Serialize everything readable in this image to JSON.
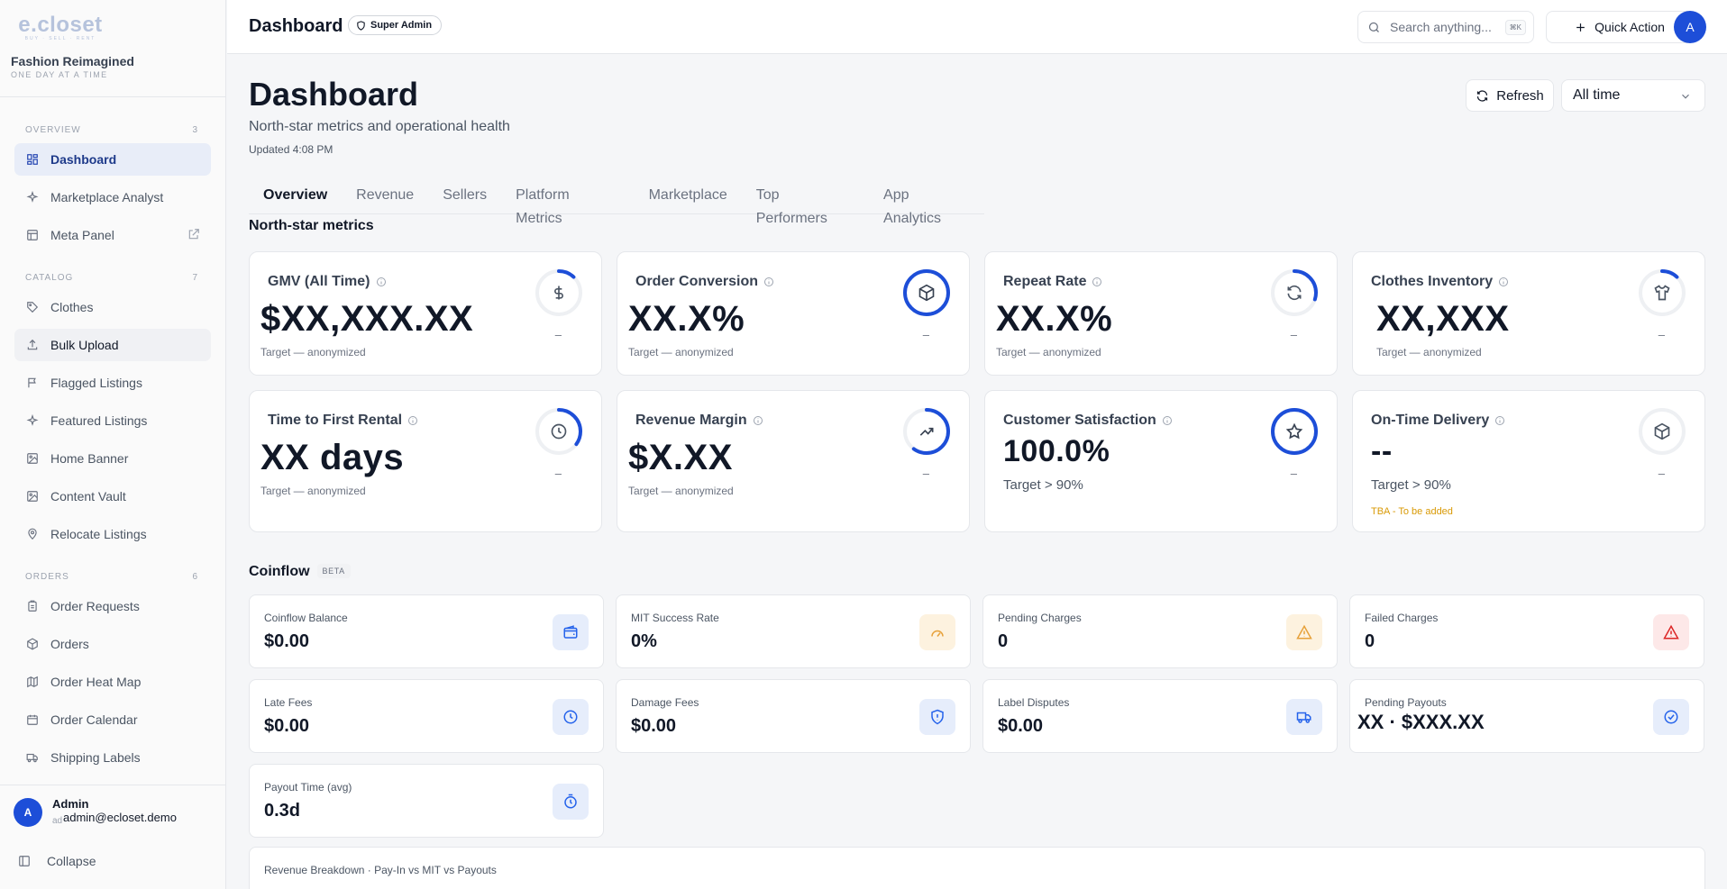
{
  "brand": {
    "logo": "e.closet",
    "logo_tagline": "BUY · SELL · RENT",
    "title": "Fashion Reimagined",
    "tagline": "ONE DAY AT A TIME"
  },
  "sidebar": {
    "sections": [
      {
        "label": "OVERVIEW",
        "count": "3",
        "items": [
          {
            "label": "Dashboard",
            "icon": "grid-icon",
            "state": "active"
          },
          {
            "label": "Marketplace Analyst",
            "icon": "sparkles-icon"
          },
          {
            "label": "Meta Panel",
            "icon": "table-icon",
            "external": true
          }
        ]
      },
      {
        "label": "CATALOG",
        "count": "7",
        "items": [
          {
            "label": "Clothes",
            "icon": "tag-icon"
          },
          {
            "label": "Bulk Upload",
            "icon": "upload-icon",
            "state": "hover"
          },
          {
            "label": "Flagged Listings",
            "icon": "flag-icon"
          },
          {
            "label": "Featured Listings",
            "icon": "sparkles-icon"
          },
          {
            "label": "Home Banner",
            "icon": "image-icon"
          },
          {
            "label": "Content Vault",
            "icon": "image-icon"
          },
          {
            "label": "Relocate Listings",
            "icon": "map-pin-icon"
          }
        ]
      },
      {
        "label": "ORDERS",
        "count": "6",
        "items": [
          {
            "label": "Order Requests",
            "icon": "clipboard-icon"
          },
          {
            "label": "Orders",
            "icon": "package-icon"
          },
          {
            "label": "Order Heat Map",
            "icon": "map-icon"
          },
          {
            "label": "Order Calendar",
            "icon": "calendar-icon"
          },
          {
            "label": "Shipping Labels",
            "icon": "truck-icon"
          }
        ]
      }
    ],
    "user": {
      "initial": "A",
      "name": "Admin",
      "email_prefix": "ad",
      "email": "admin@ecloset.demo"
    },
    "collapse_label": "Collapse"
  },
  "topbar": {
    "title": "Dashboard",
    "role_badge": "Super Admin",
    "search_placeholder": "Search anything...",
    "search_shortcut": "⌘K",
    "quick_action": "Quick Action",
    "avatar": "A"
  },
  "page": {
    "title": "Dashboard",
    "subtitle": "North-star metrics and operational health",
    "updated": "Updated 4:08 PM",
    "refresh": "Refresh",
    "range": "All time"
  },
  "tabs": [
    "Overview",
    "Revenue",
    "Sellers",
    "Platform Metrics",
    "Marketplace",
    "Top Performers",
    "App Analytics"
  ],
  "north_star": {
    "title": "North-star metrics",
    "cards": [
      {
        "title": "GMV (All Time)",
        "value": "$XX,XXX.XX",
        "target": "Target — anonymized",
        "progress": 0.12,
        "icon": "dollar-icon",
        "trend": "–"
      },
      {
        "title": "Order Conversion",
        "value": "XX.X%",
        "target": "Target — anonymized",
        "progress": 1.0,
        "icon": "package-icon",
        "trend": "–"
      },
      {
        "title": "Repeat Rate",
        "value": "XX.X%",
        "target": "Target — anonymized",
        "progress": 0.3,
        "icon": "refresh-icon",
        "trend": "–"
      },
      {
        "title": "Clothes Inventory",
        "value": "XX,XXX",
        "target": "Target — anonymized",
        "progress": 0.12,
        "icon": "shirt-icon",
        "trend": "–"
      },
      {
        "title": "Time to First Rental",
        "value": "XX days",
        "target": "Target — anonymized",
        "progress": 0.35,
        "icon": "clock-icon",
        "trend": "–"
      },
      {
        "title": "Revenue Margin",
        "value": "$X.XX",
        "target": "Target — anonymized",
        "progress": 0.6,
        "icon": "trending-up-icon",
        "trend": "–"
      },
      {
        "title": "Customer Satisfaction",
        "value": "100.0%",
        "target": "Target > 90%",
        "progress": 1.0,
        "icon": "star-icon",
        "trend": "–"
      },
      {
        "title": "On-Time Delivery",
        "value": "--",
        "target": "Target > 90%",
        "note": "TBA - To be added",
        "progress": 0,
        "icon": "package-icon",
        "trend": "–"
      }
    ]
  },
  "coinflow": {
    "title": "Coinflow",
    "badge": "BETA",
    "cards": [
      {
        "label": "Coinflow Balance",
        "value": "$0.00",
        "icon": "wallet-icon",
        "tone": "blue"
      },
      {
        "label": "MIT Success Rate",
        "value": "0%",
        "icon": "gauge-icon",
        "tone": "amber"
      },
      {
        "label": "Pending Charges",
        "value": "0",
        "icon": "alert-triangle-icon",
        "tone": "amber"
      },
      {
        "label": "Failed Charges",
        "value": "0",
        "icon": "alert-triangle-icon",
        "tone": "red"
      },
      {
        "label": "Late Fees",
        "value": "$0.00",
        "icon": "clock-icon",
        "tone": "blue"
      },
      {
        "label": "Damage Fees",
        "value": "$0.00",
        "icon": "shield-alert-icon",
        "tone": "blue"
      },
      {
        "label": "Label Disputes",
        "value": "$0.00",
        "icon": "truck-icon",
        "tone": "blue"
      },
      {
        "label": "Pending Payouts",
        "value": "XX · $XXX.XX",
        "icon": "check-circle-icon",
        "tone": "blue"
      },
      {
        "label": "Payout Time (avg)",
        "value": "0.3d",
        "icon": "timer-icon",
        "tone": "blue"
      }
    ]
  },
  "breakdown": {
    "title": "Revenue Breakdown · Pay-In vs MIT vs Payouts"
  },
  "colors": {
    "accent": "#1d4ed8",
    "ring_track": "#eef0f3",
    "warning": "#d99a06"
  }
}
